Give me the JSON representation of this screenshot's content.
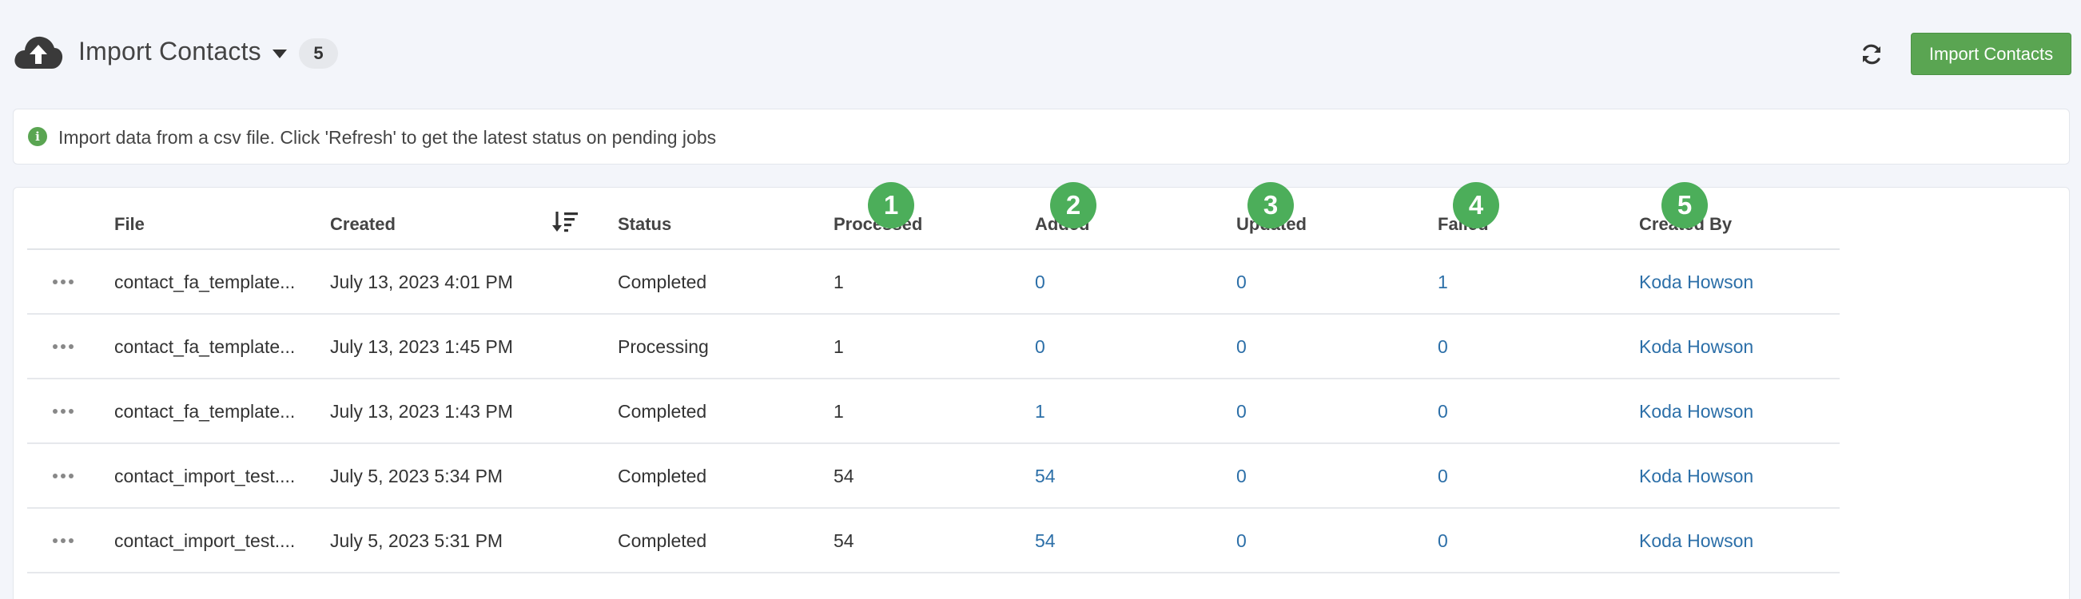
{
  "header": {
    "title": "Import Contacts",
    "count": "5",
    "import_button_label": "Import Contacts",
    "icons": {
      "upload": "cloud-upload-icon",
      "menu": "caret-down-icon",
      "refresh": "refresh-icon"
    }
  },
  "info_banner": {
    "text": "Import data from a csv file. Click 'Refresh' to get the latest status on pending jobs",
    "icon": "info-icon"
  },
  "table": {
    "columns": {
      "file": "File",
      "created": "Created",
      "status": "Status",
      "processed": "Processed",
      "added": "Added",
      "updated": "Updated",
      "failed": "Failed",
      "created_by": "Created By"
    },
    "step_markers": [
      "1",
      "2",
      "3",
      "4",
      "5"
    ],
    "rows": [
      {
        "file": "contact_fa_template...",
        "created": "July 13, 2023 4:01 PM",
        "status": "Completed",
        "processed": "1",
        "added": "0",
        "updated": "0",
        "failed": "1",
        "created_by": "Koda Howson"
      },
      {
        "file": "contact_fa_template...",
        "created": "July 13, 2023 1:45 PM",
        "status": "Processing",
        "processed": "1",
        "added": "0",
        "updated": "0",
        "failed": "0",
        "created_by": "Koda Howson"
      },
      {
        "file": "contact_fa_template...",
        "created": "July 13, 2023 1:43 PM",
        "status": "Completed",
        "processed": "1",
        "added": "1",
        "updated": "0",
        "failed": "0",
        "created_by": "Koda Howson"
      },
      {
        "file": "contact_import_test....",
        "created": "July 5, 2023 5:34 PM",
        "status": "Completed",
        "processed": "54",
        "added": "54",
        "updated": "0",
        "failed": "0",
        "created_by": "Koda Howson"
      },
      {
        "file": "contact_import_test....",
        "created": "July 5, 2023 5:31 PM",
        "status": "Completed",
        "processed": "54",
        "added": "54",
        "updated": "0",
        "failed": "0",
        "created_by": "Koda Howson"
      }
    ]
  },
  "colors": {
    "accent_green": "#5aa552",
    "step_marker_green": "#4cae5a",
    "link_blue": "#2c6fa8",
    "page_background": "#f3f5fa"
  }
}
